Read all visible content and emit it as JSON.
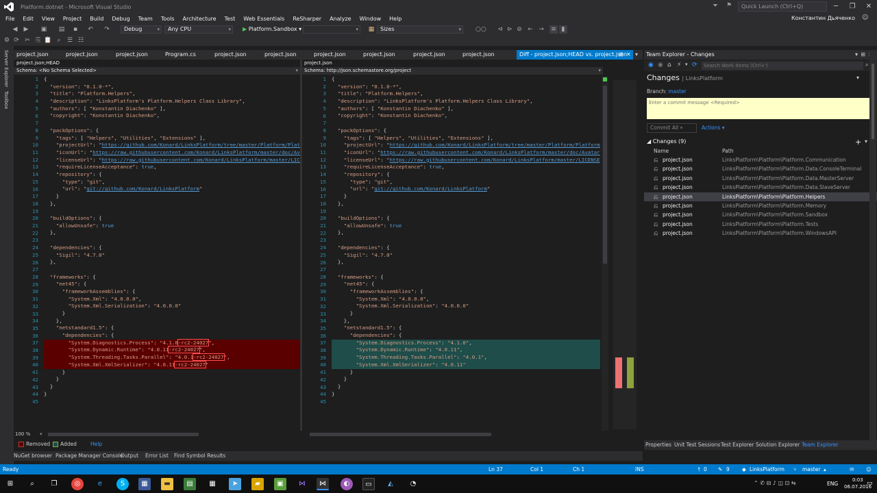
{
  "window": {
    "title": "Platform.dotnet - Microsoft Visual Studio",
    "quick_launch": "Quick Launch (Ctrl+Q)",
    "user": "Константин Дьяченко"
  },
  "menu": [
    "File",
    "Edit",
    "View",
    "Project",
    "Build",
    "Debug",
    "Team",
    "Tools",
    "Architecture",
    "Test",
    "Web Essentials",
    "ReSharper",
    "Analyze",
    "Window",
    "Help"
  ],
  "toolbar": {
    "config": "Debug",
    "platform": "Any CPU",
    "start_project": "Platform.Sandbox",
    "find": "Sizes"
  },
  "side_tabs": [
    "Server Explorer",
    "Toolbox"
  ],
  "tabs": [
    "project.json",
    "project.json",
    "project.json",
    "Program.cs",
    "project.json",
    "project.json",
    "project.json",
    "project.json",
    "project.json",
    "project.json",
    "Diff - project.json;HEAD vs. project.json"
  ],
  "left_pane": {
    "header": "project.json;HEAD",
    "schema_label": "Schema:",
    "schema": "<No Schema Selected>"
  },
  "right_pane": {
    "header": "project.json",
    "schema_label": "Schema:",
    "schema": "http://json.schemastore.org/project"
  },
  "code_left": [
    "{",
    "  \"version\": \"0.1.0-*\",",
    "  \"title\": \"Platform.Helpers\",",
    "  \"description\": \"LinksPlatform's Platform.Helpers Class Library\",",
    "  \"authors\": [ \"Konstantin Diachenko\" ],",
    "  \"copyright\": \"Konstantin Diachenko\",",
    "",
    "  \"packOptions\": {",
    "    \"tags\": [ \"Helpers\", \"Utilities\", \"Extensions\" ],",
    "    \"projectUrl\": \"https://github.com/Konard/LinksPlatform/tree/master/Platform/Platform.Helpers\",",
    "    \"iconUrl\": \"https://raw.githubusercontent.com/Konard/LinksPlatform/master/doc/Avatar-rainbow.png\",",
    "    \"licenseUrl\": \"https://raw.githubusercontent.com/Konard/LinksPlatform/master/LICENSE\",",
    "    \"requireLicenseAcceptance\": true,",
    "    \"repository\": {",
    "      \"type\": \"git\",",
    "      \"url\": \"git://github.com/Konard/LinksPlatform\"",
    "    }",
    "  },",
    "",
    "  \"buildOptions\": {",
    "    \"allowUnsafe\": true",
    "  },",
    "",
    "  \"dependencies\": {",
    "    \"Sigil\": \"4.7.0\"",
    "  },",
    "",
    "  \"frameworks\": {",
    "    \"net45\": {",
    "      \"frameworkAssemblies\": {",
    "        \"System.Xml\": \"4.0.0.0\",",
    "        \"System.Xml.Serialization\": \"4.0.0.0\"",
    "      }",
    "    },",
    "    \"netstandard1.5\": {",
    "      \"dependencies\": {",
    "        \"System.Diagnostics.Process\": \"4.1.0-rc2-24027\",",
    "        \"System.Dynamic.Runtime\": \"4.0.11-rc2-24027\",",
    "        \"System.Threading.Tasks.Parallel\": \"4.0.1-rc2-24027\",",
    "        \"System.Xml.XmlSerializer\": \"4.0.11-rc2-24027\"",
    "      }",
    "    }",
    "  }",
    "}",
    ""
  ],
  "code_right_changed": [
    "        \"System.Diagnostics.Process\": \"4.1.0\",",
    "        \"System.Dynamic.Runtime\": \"4.0.11\",",
    "        \"System.Threading.Tasks.Parallel\": \"4.0.1\",",
    "        \"System.Xml.XmlSerializer\": \"4.0.11\""
  ],
  "zoom": "100 %",
  "legend": {
    "removed": "Removed",
    "added": "Added",
    "help": "Help"
  },
  "output_tabs": [
    "NuGet browser",
    "Package Manager Console",
    "Output",
    "Error List",
    "Find Symbol Results"
  ],
  "team_explorer": {
    "title": "Team Explorer - Changes",
    "search": "Search Work Items (Ctrl+')",
    "heading": "Changes",
    "repo": "LinksPlatform",
    "branch_label": "Branch:",
    "branch": "master",
    "commit_placeholder": "Enter a commit message <Required>",
    "commit_all": "Commit All",
    "actions": "Actions",
    "changes_header": "Changes (9)",
    "col_name": "Name",
    "col_path": "Path",
    "items": [
      {
        "name": "project.json",
        "path": "LinksPlatform\\Platform\\Platform.Communication"
      },
      {
        "name": "project.json",
        "path": "LinksPlatform\\Platform\\Platform.Data.ConsoleTerminal"
      },
      {
        "name": "project.json",
        "path": "LinksPlatform\\Platform\\Platform.Data.MasterServer"
      },
      {
        "name": "project.json",
        "path": "LinksPlatform\\Platform\\Platform.Data.SlaveServer"
      },
      {
        "name": "project.json",
        "path": "LinksPlatform\\Platform\\Platform.Helpers"
      },
      {
        "name": "project.json",
        "path": "LinksPlatform\\Platform\\Platform.Memory"
      },
      {
        "name": "project.json",
        "path": "LinksPlatform\\Platform\\Platform.Sandbox"
      },
      {
        "name": "project.json",
        "path": "LinksPlatform\\Platform\\Platform.Tests"
      },
      {
        "name": "project.json",
        "path": "LinksPlatform\\Platform\\Platform.WindowsAPI"
      }
    ]
  },
  "te_bottom_tabs": [
    "Properties",
    "Unit Test Sessions",
    "Test Explorer",
    "Solution Explorer",
    "Team Explorer"
  ],
  "status": {
    "ready": "Ready",
    "ln": "Ln 37",
    "col": "Col 1",
    "ch": "Ch 1",
    "ins": "INS",
    "up": "0",
    "pencil": "9",
    "repo": "LinksPlatform",
    "branch": "master"
  },
  "taskbar": {
    "lang": "ENG",
    "time": "0:03",
    "date": "06.07.2016"
  }
}
